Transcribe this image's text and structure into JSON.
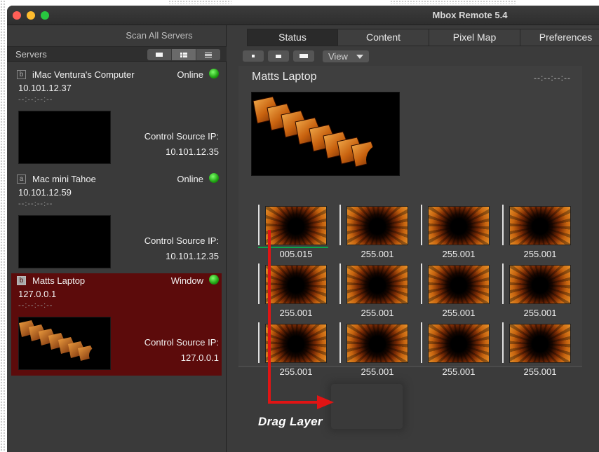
{
  "window": {
    "title": "Mbox Remote 5.4"
  },
  "sidebar": {
    "scan_button": "Scan All Servers",
    "header_label": "Servers",
    "view_buttons": [
      "large-thumbnail-view-icon",
      "medium-thumbnail-view-icon",
      "list-view-icon"
    ],
    "servers": [
      {
        "letter": "b",
        "name": "iMac Ventura's Computer",
        "status": "Online",
        "ip": "10.101.12.37",
        "timecode": "--:--:--:--",
        "cs_label": "Control Source IP:",
        "cs_ip": "10.101.12.35",
        "selected": false
      },
      {
        "letter": "a",
        "name": "Mac mini Tahoe",
        "status": "Online",
        "ip": "10.101.12.59",
        "timecode": "--:--:--:--",
        "cs_label": "Control Source IP:",
        "cs_ip": "10.101.12.35",
        "selected": false
      },
      {
        "letter": "b",
        "name": "Matts Laptop",
        "status": "Window",
        "ip": "127.0.0.1",
        "timecode": "--:--:--:--",
        "cs_label": "Control Source IP:",
        "cs_ip": "127.0.0.1",
        "selected": true
      }
    ]
  },
  "main": {
    "tabs": [
      "Status",
      "Content",
      "Pixel Map",
      "Preferences"
    ],
    "active_tab": "Status",
    "view_label": "View",
    "server_title": "Matts Laptop",
    "timecode": "--:--:--:--",
    "layers": [
      {
        "value": "005.015"
      },
      {
        "value": "255.001"
      },
      {
        "value": "255.001"
      },
      {
        "value": "255.001"
      },
      {
        "value": "255.001"
      },
      {
        "value": "255.001"
      },
      {
        "value": "255.001"
      },
      {
        "value": "255.001"
      },
      {
        "value": "255.001"
      },
      {
        "value": "255.001"
      },
      {
        "value": "255.001"
      },
      {
        "value": "255.001"
      }
    ],
    "layer_progress": 0.96,
    "annotation": "Drag Layer"
  },
  "colors": {
    "selected_row": "#5c0b0b",
    "status_led": "#1fa012",
    "annotation_arrow": "#e11414",
    "progress": "#0aa64b"
  }
}
